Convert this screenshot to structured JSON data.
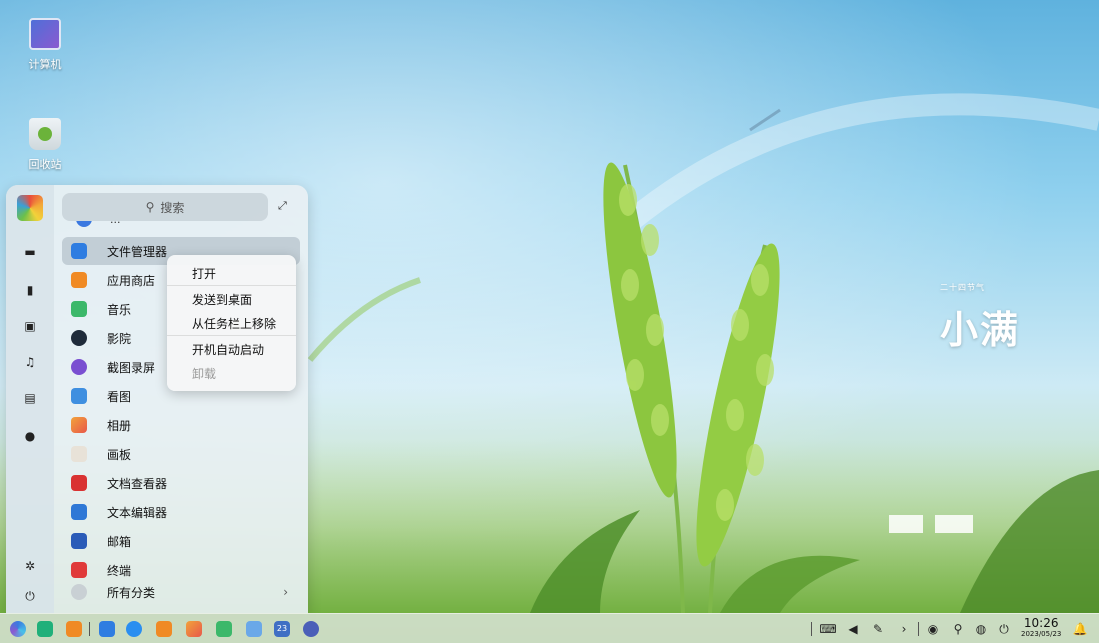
{
  "desktop": {
    "icons": [
      {
        "label": "计算机"
      },
      {
        "label": "回收站"
      }
    ]
  },
  "wallpaper": {
    "solar_term_caption": "二十四节气",
    "solar_term_name": "小满"
  },
  "launcher": {
    "search_placeholder": "搜索",
    "partial_item": "...",
    "apps": [
      {
        "label": "文件管理器",
        "icon": "file-manager-icon",
        "color": "#2f7de1"
      },
      {
        "label": "应用商店",
        "icon": "app-store-icon",
        "color": "#f08a24"
      },
      {
        "label": "音乐",
        "icon": "music-icon",
        "color": "#3cb86a"
      },
      {
        "label": "影院",
        "icon": "movie-icon",
        "color": "#1f2b3a"
      },
      {
        "label": "截图录屏",
        "icon": "screenshot-icon",
        "color": "#7a4fd1"
      },
      {
        "label": "看图",
        "icon": "image-viewer-icon",
        "color": "#3f8fe0"
      },
      {
        "label": "相册",
        "icon": "album-icon",
        "color": "#e8584a"
      },
      {
        "label": "画板",
        "icon": "drawing-board-icon",
        "color": "#e8e2d8"
      },
      {
        "label": "文档查看器",
        "icon": "document-viewer-icon",
        "color": "#d93232"
      },
      {
        "label": "文本编辑器",
        "icon": "text-editor-icon",
        "color": "#2f78d6"
      },
      {
        "label": "邮箱",
        "icon": "mail-icon",
        "color": "#2a5bb8"
      },
      {
        "label": "终端",
        "icon": "terminal-icon",
        "color": "#e03a3a"
      }
    ],
    "all_categories": "所有分类",
    "all_categories_arrow": "›"
  },
  "context_menu": {
    "items": [
      "打开",
      "发送到桌面",
      "从任务栏上移除",
      "开机自动启动",
      "卸载"
    ]
  },
  "taskbar": {
    "time": "10:26",
    "date": "2023/05/23",
    "calendar_day": "23"
  }
}
